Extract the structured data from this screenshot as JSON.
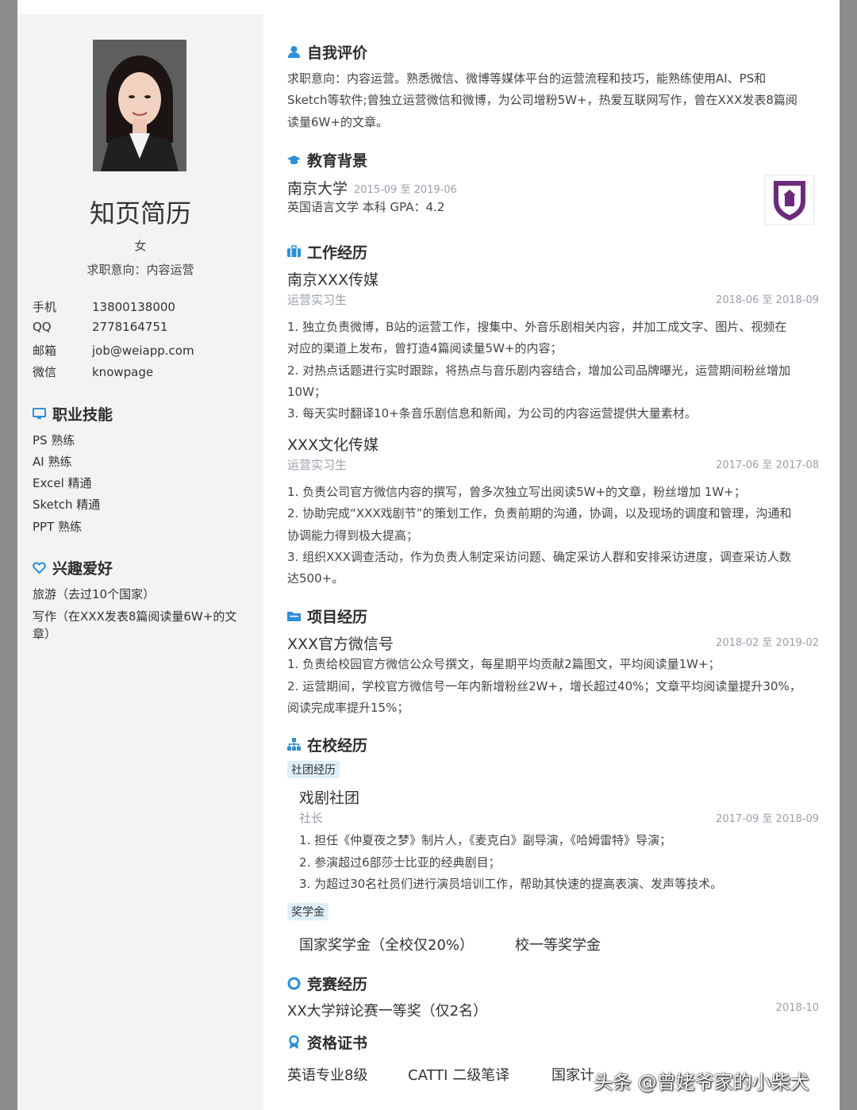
{
  "sidebar": {
    "name": "知页简历",
    "gender": "女",
    "job_intent": "求职意向：内容运营",
    "contacts": [
      {
        "label": "手机",
        "value": "13800138000"
      },
      {
        "label": "QQ",
        "value": "2778164751"
      },
      {
        "label": "邮箱",
        "value": "job@weiapp.com"
      },
      {
        "label": "微信",
        "value": "knowpage"
      }
    ],
    "skills_title": "职业技能",
    "skills": [
      "PS 熟练",
      "AI 熟练",
      "Excel 精通",
      "Sketch 精通",
      "PPT 熟练"
    ],
    "hobbies_title": "兴趣爱好",
    "hobbies": [
      "旅游（去过10个国家）",
      "写作（在XXX发表8篇阅读量6W+的文",
      "章）"
    ]
  },
  "self_eval": {
    "title": "自我评价",
    "lines": [
      "求职意向：内容运营。熟悉微信、微博等媒体平台的运营流程和技巧，能熟练使用AI、PS和",
      "Sketch等软件;曾独立运营微信和微博，为公司增粉5W+，热爱互联网写作，曾在XXX发表8篇阅",
      "读量6W+的文章。"
    ]
  },
  "education": {
    "title": "教育背景",
    "school": "南京大学",
    "date": "2015-09 至 2019-06",
    "detail": "英国语言文学  本科  GPA：4.2"
  },
  "work": {
    "title": "工作经历",
    "jobs": [
      {
        "org": "南京XXX传媒",
        "role": "运营实习生",
        "date": "2018-06 至 2018-09",
        "lines": [
          "1.  独立负责微博，B站的运营工作，搜集中、外音乐剧相关内容，并加工成文字、图片、视频在",
          "对应的渠道上发布，曾打造4篇阅读量5W+的内容；",
          "2. 对热点话题进行实时跟踪，将热点与音乐剧内容结合，增加公司品牌曝光，运营期间粉丝增加",
          "10W；",
          "3. 每天实时翻译10+条音乐剧信息和新闻，为公司的内容运营提供大量素材。"
        ]
      },
      {
        "org": "XXX文化传媒",
        "role": "运营实习生",
        "date": "2017-06 至 2017-08",
        "lines": [
          "1. 负责公司官方微信内容的撰写，曾多次独立写出阅读5W+的文章，粉丝增加 1W+；",
          "2. 协助完成“XXX戏剧节”的策划工作，负责前期的沟通，协调，以及现场的调度和管理，沟通和",
          "协调能力得到极大提高；",
          "3. 组织XXX调查活动，作为负责人制定采访问题、确定采访人群和安排采访进度，调查采访人数",
          "达500+。"
        ]
      }
    ]
  },
  "project": {
    "title": "项目经历",
    "name": "XXX官方微信号",
    "date": "2018-02 至 2019-02",
    "lines": [
      "1. 负责给校园官方微信公众号撰文，每星期平均贡献2篇图文，平均阅读量1W+；",
      "2. 运营期间，学校官方微信号一年内新增粉丝2W+，增长超过40%；文章平均阅读量提升30%，",
      "阅读完成率提升15%；"
    ]
  },
  "campus": {
    "title": "在校经历",
    "club_tag": "社团经历",
    "club": "戏剧社团",
    "club_role": "社长",
    "club_date": "2017-09 至 2018-09",
    "club_lines": [
      "1. 担任《仲夏夜之梦》制片人，《麦克白》副导演，《哈姆雷特》导演；",
      "2. 参演超过6部莎士比亚的经典剧目；",
      "3. 为超过30名社员们进行演员培训工作，帮助其快速的提高表演、发声等技术。"
    ],
    "scholar_tag": "奖学金",
    "scholarships": [
      "国家奖学金（全校仅20%）",
      "校一等奖学金"
    ]
  },
  "competition": {
    "title": "竞赛经历",
    "name": "XX大学辩论赛一等奖（仅2名）",
    "date": "2018-10"
  },
  "certs": {
    "title": "资格证书",
    "items": [
      "英语专业8级",
      "CATTI 二级笔译",
      "国家计"
    ]
  },
  "watermark": "头条 @曾姥爷家的小柴犬",
  "colors": {
    "accent": "#2d8fd5",
    "sidebar_bg": "#f3f3f3",
    "date_gray": "#9aa0aa"
  }
}
